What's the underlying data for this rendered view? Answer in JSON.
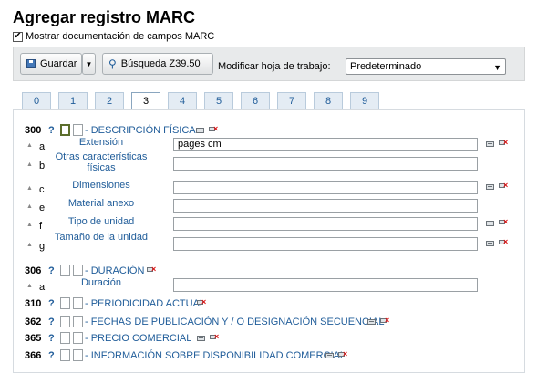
{
  "page": {
    "title": "Agregar registro MARC",
    "show_doc_label": "Mostrar documentación de campos MARC",
    "show_doc_checked": true
  },
  "toolbar": {
    "save_label": "Guardar",
    "z3950_label": "Búsqueda Z39.50",
    "worksheet_label": "Modificar hoja de trabajo:",
    "worksheet_value": "Predeterminado"
  },
  "tabs": [
    "0",
    "1",
    "2",
    "3",
    "4",
    "5",
    "6",
    "7",
    "8",
    "9"
  ],
  "active_tab": "3",
  "fields": [
    {
      "tag": "300",
      "q": "?",
      "name": "- DESCRIPCIÓN FÍSICA",
      "subfields": [
        {
          "code": "a",
          "label": "Extensión",
          "value": "pages cm"
        },
        {
          "code": "b",
          "label": "Otras características físicas",
          "value": ""
        },
        {
          "code": "c",
          "label": "Dimensiones",
          "value": ""
        },
        {
          "code": "e",
          "label": "Material anexo",
          "value": ""
        },
        {
          "code": "f",
          "label": "Tipo de unidad",
          "value": ""
        },
        {
          "code": "g",
          "label": "Tamaño de la unidad",
          "value": ""
        }
      ]
    },
    {
      "tag": "306",
      "q": "?",
      "name": "- DURACIÓN",
      "subfields": [
        {
          "code": "a",
          "label": "Duración",
          "value": ""
        }
      ]
    },
    {
      "tag": "310",
      "q": "?",
      "name": "- PERIODICIDAD ACTUAL"
    },
    {
      "tag": "362",
      "q": "?",
      "name": "- FECHAS DE PUBLICACIÓN Y / O DESIGNACIÓN SECUENCIAL"
    },
    {
      "tag": "365",
      "q": "?",
      "name": "- PRECIO COMERCIAL"
    },
    {
      "tag": "366",
      "q": "?",
      "name": "- INFORMACIÓN SOBRE DISPONIBILIDAD COMERCIAL"
    }
  ],
  "colors": {
    "link": "#1f5c99",
    "delete": "#dd1111"
  }
}
